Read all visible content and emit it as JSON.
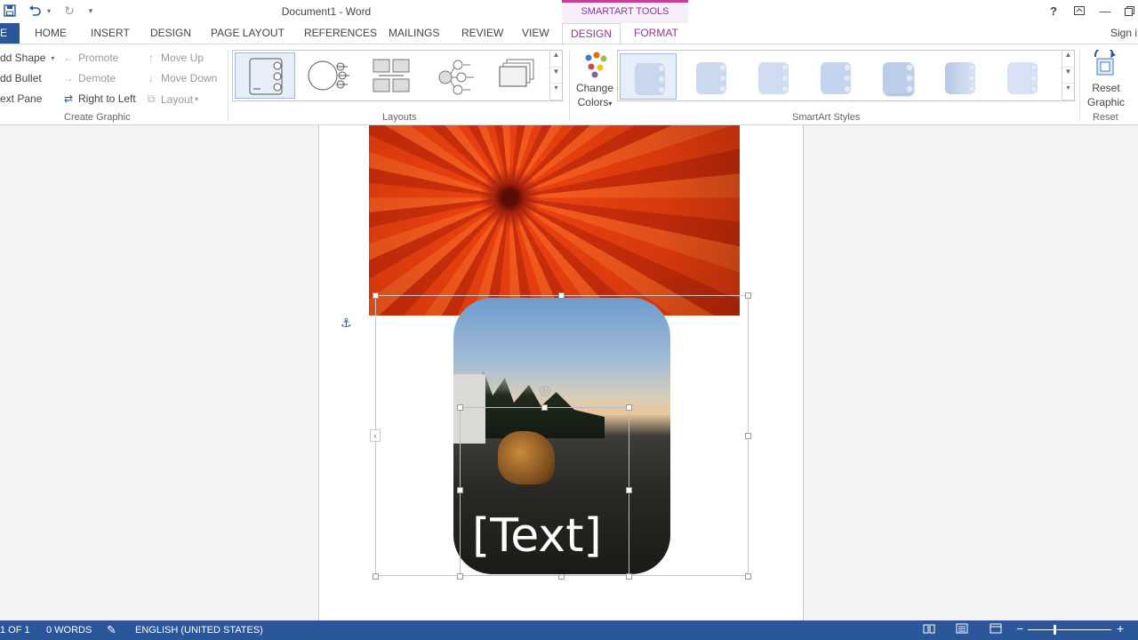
{
  "window": {
    "title": "Document1 - Word",
    "contextual_group": "SMARTART TOOLS",
    "help_icon": "question-icon",
    "controls": [
      "ribbon-display-icon",
      "minimize-icon",
      "restore-icon"
    ]
  },
  "qat": {
    "icons": [
      "save-icon",
      "undo-icon",
      "redo-icon",
      "customize-icon"
    ]
  },
  "tabs": {
    "file": "E",
    "home": "HOME",
    "insert": "INSERT",
    "design": "DESIGN",
    "page_layout": "PAGE LAYOUT",
    "references": "REFERENCES",
    "mailings": "MAILINGS",
    "review": "REVIEW",
    "view": "VIEW",
    "smart_design": "DESIGN",
    "smart_format": "FORMAT",
    "sign_in": "Sign i"
  },
  "ribbon": {
    "create_graphic": {
      "label": "Create Graphic",
      "add_shape": "dd Shape",
      "add_bullet": "dd Bullet",
      "text_pane": "ext Pane",
      "promote": "Promote",
      "demote": "Demote",
      "right_to_left": "Right to Left",
      "move_up": "Move Up",
      "move_down": "Move Down",
      "layout": "Layout"
    },
    "layouts": {
      "label": "Layouts",
      "selected_index": 0,
      "count": 5
    },
    "change_colors": {
      "line1": "Change",
      "line2": "Colors"
    },
    "smartart_styles": {
      "label": "SmartArt Styles",
      "selected_index": 0,
      "count": 7
    },
    "reset": {
      "label": "Reset",
      "line1": "Reset",
      "line2": "Graphic"
    }
  },
  "document": {
    "placeholder_text": "[Text]"
  },
  "status": {
    "page": "1 OF 1",
    "words": "0 WORDS",
    "language": "ENGLISH (UNITED STATES)"
  },
  "colors": {
    "accent": "#2b579a",
    "contextual": "#8b3b8b",
    "contextual_top": "#c43e9b"
  }
}
